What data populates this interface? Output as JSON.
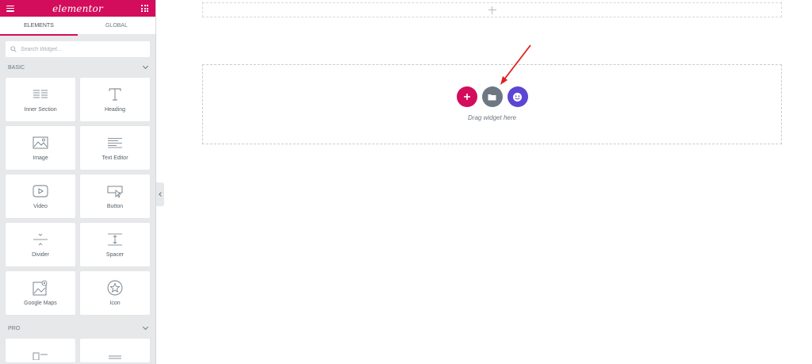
{
  "topbar": {
    "logo": "elementor",
    "brand_color": "#d30c5c"
  },
  "tabs": [
    {
      "label": "ELEMENTS",
      "active": true
    },
    {
      "label": "GLOBAL",
      "active": false
    }
  ],
  "search": {
    "placeholder": "Search Widget..."
  },
  "categories": {
    "basic": {
      "title": "BASIC",
      "widgets": [
        {
          "label": "Inner Section",
          "icon": "inner-section-icon"
        },
        {
          "label": "Heading",
          "icon": "heading-icon"
        },
        {
          "label": "Image",
          "icon": "image-icon"
        },
        {
          "label": "Text Editor",
          "icon": "text-editor-icon"
        },
        {
          "label": "Video",
          "icon": "video-icon"
        },
        {
          "label": "Button",
          "icon": "button-icon"
        },
        {
          "label": "Divider",
          "icon": "divider-icon"
        },
        {
          "label": "Spacer",
          "icon": "spacer-icon"
        },
        {
          "label": "Google Maps",
          "icon": "google-maps-icon"
        },
        {
          "label": "Icon",
          "icon": "star-icon"
        }
      ]
    },
    "pro": {
      "title": "PRO"
    }
  },
  "canvas": {
    "drop_text": "Drag widget here",
    "buttons": [
      {
        "name": "add-section",
        "color": "#d30c5c",
        "icon": "plus-icon"
      },
      {
        "name": "add-template",
        "color": "#6d7882",
        "icon": "folder-icon"
      },
      {
        "name": "envato-kit",
        "color": "#5d45d4",
        "icon": "emoji-icon"
      }
    ],
    "arrow_color": "#e02020"
  }
}
